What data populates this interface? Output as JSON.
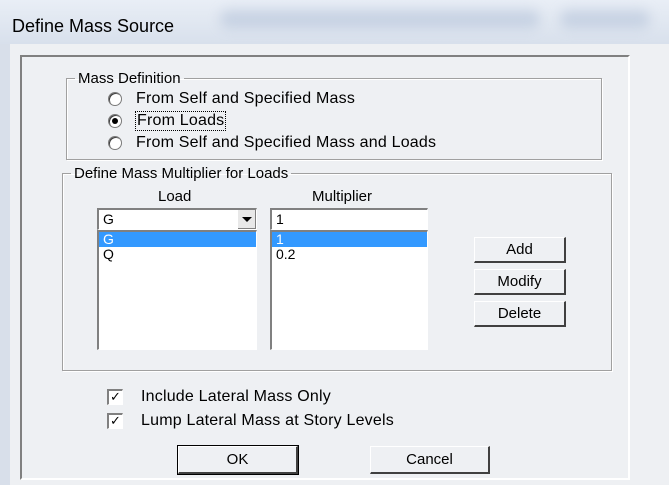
{
  "window": {
    "title": "Define Mass Source"
  },
  "mass_definition": {
    "legend": "Mass Definition",
    "options": [
      {
        "label": "From Self and Specified Mass",
        "selected": false
      },
      {
        "label": "From Loads",
        "selected": true
      },
      {
        "label": "From Self and Specified Mass and Loads",
        "selected": false
      }
    ]
  },
  "multiplier_group": {
    "legend": "Define Mass Multiplier for Loads",
    "load_header": "Load",
    "multiplier_header": "Multiplier",
    "load_value": "G",
    "multiplier_value": "1",
    "load_list": [
      "G",
      "Q"
    ],
    "multiplier_list": [
      "1",
      "0.2"
    ],
    "add_label": "Add",
    "modify_label": "Modify",
    "delete_label": "Delete"
  },
  "options": {
    "include_lateral": {
      "label": "Include Lateral Mass Only",
      "checked": true,
      "mark": "✓"
    },
    "lump_lateral": {
      "label": "Lump Lateral Mass at Story Levels",
      "checked": true,
      "mark": "✓"
    }
  },
  "footer": {
    "ok_label": "OK",
    "cancel_label": "Cancel"
  }
}
